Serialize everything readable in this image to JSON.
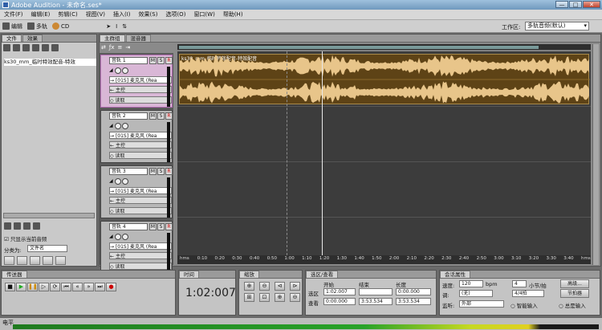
{
  "window": {
    "title": "Adobe Audition - 未命名.ses*",
    "min": "—",
    "max": "□",
    "close": "✕"
  },
  "menu": [
    "文件(F)",
    "编辑(E)",
    "剪辑(C)",
    "视图(V)",
    "插入(I)",
    "效果(S)",
    "选项(O)",
    "窗口(W)",
    "帮助(H)"
  ],
  "toolbar": {
    "edit_label": "编辑",
    "multitrack_label": "多轨",
    "cd_label": "CD",
    "workspace_label": "工作区:",
    "workspace_value": "多轨音频(默认)"
  },
  "files_panel": {
    "tabs": [
      "文件",
      "效果"
    ],
    "items": [
      "ks30_mm_临时特效配音-特效"
    ],
    "show_label": "只显示当前音频",
    "sort_label": "分类为:",
    "sort_value": "文件名"
  },
  "main_panel": {
    "tabs": [
      "主群组",
      "混音器"
    ]
  },
  "tracks": [
    {
      "name": "音轨 1",
      "input": "[01S] 麦克风 (Rea",
      "output": "主控",
      "mode": "读取"
    },
    {
      "name": "音轨 2",
      "input": "[01S] 麦克风 (Rea",
      "output": "主控",
      "mode": "读取"
    },
    {
      "name": "音轨 3",
      "input": "[01S] 麦克风 (Rea",
      "output": "主控",
      "mode": "读取"
    },
    {
      "name": "音轨 4",
      "input": "[01S] 麦克风 (Rea",
      "output": "主控",
      "mode": "读取"
    }
  ],
  "clip": {
    "title": "ks30_mm_临时特效配音-特效配音"
  },
  "ruler": [
    "hms",
    "0:10",
    "0:20",
    "0:30",
    "0:40",
    "0:50",
    "1:00",
    "1:10",
    "1:20",
    "1:30",
    "1:40",
    "1:50",
    "2:00",
    "2:10",
    "2:20",
    "2:30",
    "2:40",
    "2:50",
    "3:00",
    "3:10",
    "3:20",
    "3:30",
    "3:40",
    "hms"
  ],
  "transport": {
    "title": "传送器"
  },
  "time_panel": {
    "title": "时间",
    "value": "1:02:007"
  },
  "zoom_panel": {
    "title": "缩放"
  },
  "selection_panel": {
    "title": "选区/查看",
    "col_start": "开始",
    "col_end": "结束",
    "col_length": "长度",
    "row_sel": "选区",
    "row_view": "查看",
    "sel_start": "1:02.007",
    "sel_end": "",
    "sel_length": "0:00.000",
    "view_start": "0:00.000",
    "view_end": "3:53.534",
    "view_length": "3:53.534"
  },
  "session_panel": {
    "title": "会话属性",
    "tempo_label": "速度:",
    "tempo": "120",
    "bpm": "bpm",
    "beats": "4",
    "beats_label": "小节/拍",
    "advanced": "高级...",
    "key_label": "调:",
    "key_value": "(无)",
    "time_sig": "4/4拍",
    "metronome": "节拍器",
    "monitor_label": "监听:",
    "monitor_value": "外部",
    "smart_input": "智能输入",
    "always_input": "总是输入"
  },
  "level_panel": {
    "title": "电平"
  }
}
